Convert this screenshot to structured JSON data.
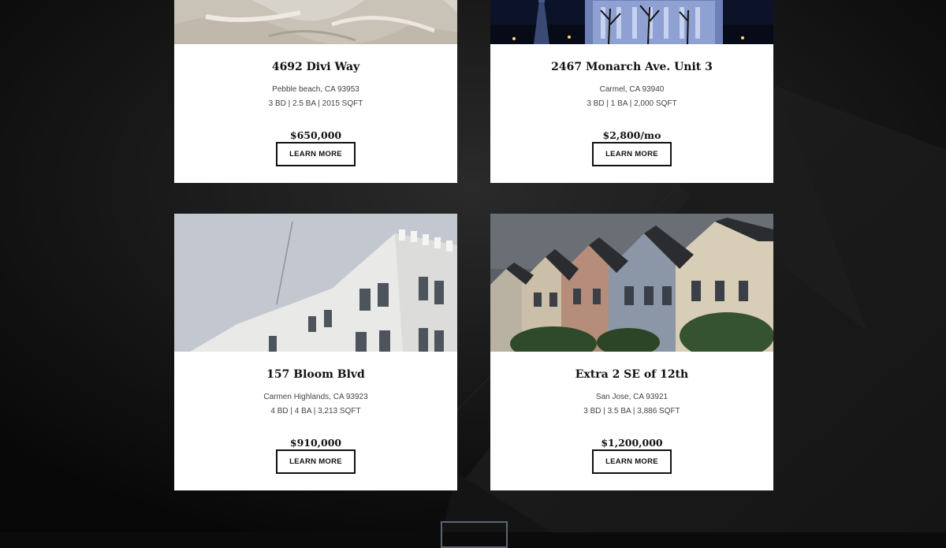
{
  "listings": [
    {
      "title": "4692 Divi Way",
      "location": "Pebble beach, CA 93953",
      "specs": "3 BD | 2.5 BA | 2015 SQFT",
      "price": "$650,000",
      "button_label": "LEARN MORE"
    },
    {
      "title": "2467 Monarch Ave. Unit 3",
      "location": "Carmel, CA 93940",
      "specs": "3 BD | 1 BA | 2,000 SQFT",
      "price": "$2,800/mo",
      "button_label": "LEARN MORE"
    },
    {
      "title": "157 Bloom Blvd",
      "location": "Carmen Highlands, CA 93923",
      "specs": "4 BD | 4 BA | 3,213 SQFT",
      "price": "$910,000",
      "button_label": "LEARN MORE"
    },
    {
      "title": "Extra 2 SE of 12th",
      "location": "San Jose, CA 93921",
      "specs": "3 BD | 3.5 BA | 3,886 SQFT",
      "price": "$1,200,000",
      "button_label": "LEARN MORE"
    }
  ],
  "more_button": {
    "label": ""
  },
  "colors": {
    "page_background": "#0b0b0b",
    "card_background": "#ffffff",
    "text_dark": "#111111",
    "text_muted": "#444444",
    "more_button_border": "#5a6675"
  }
}
